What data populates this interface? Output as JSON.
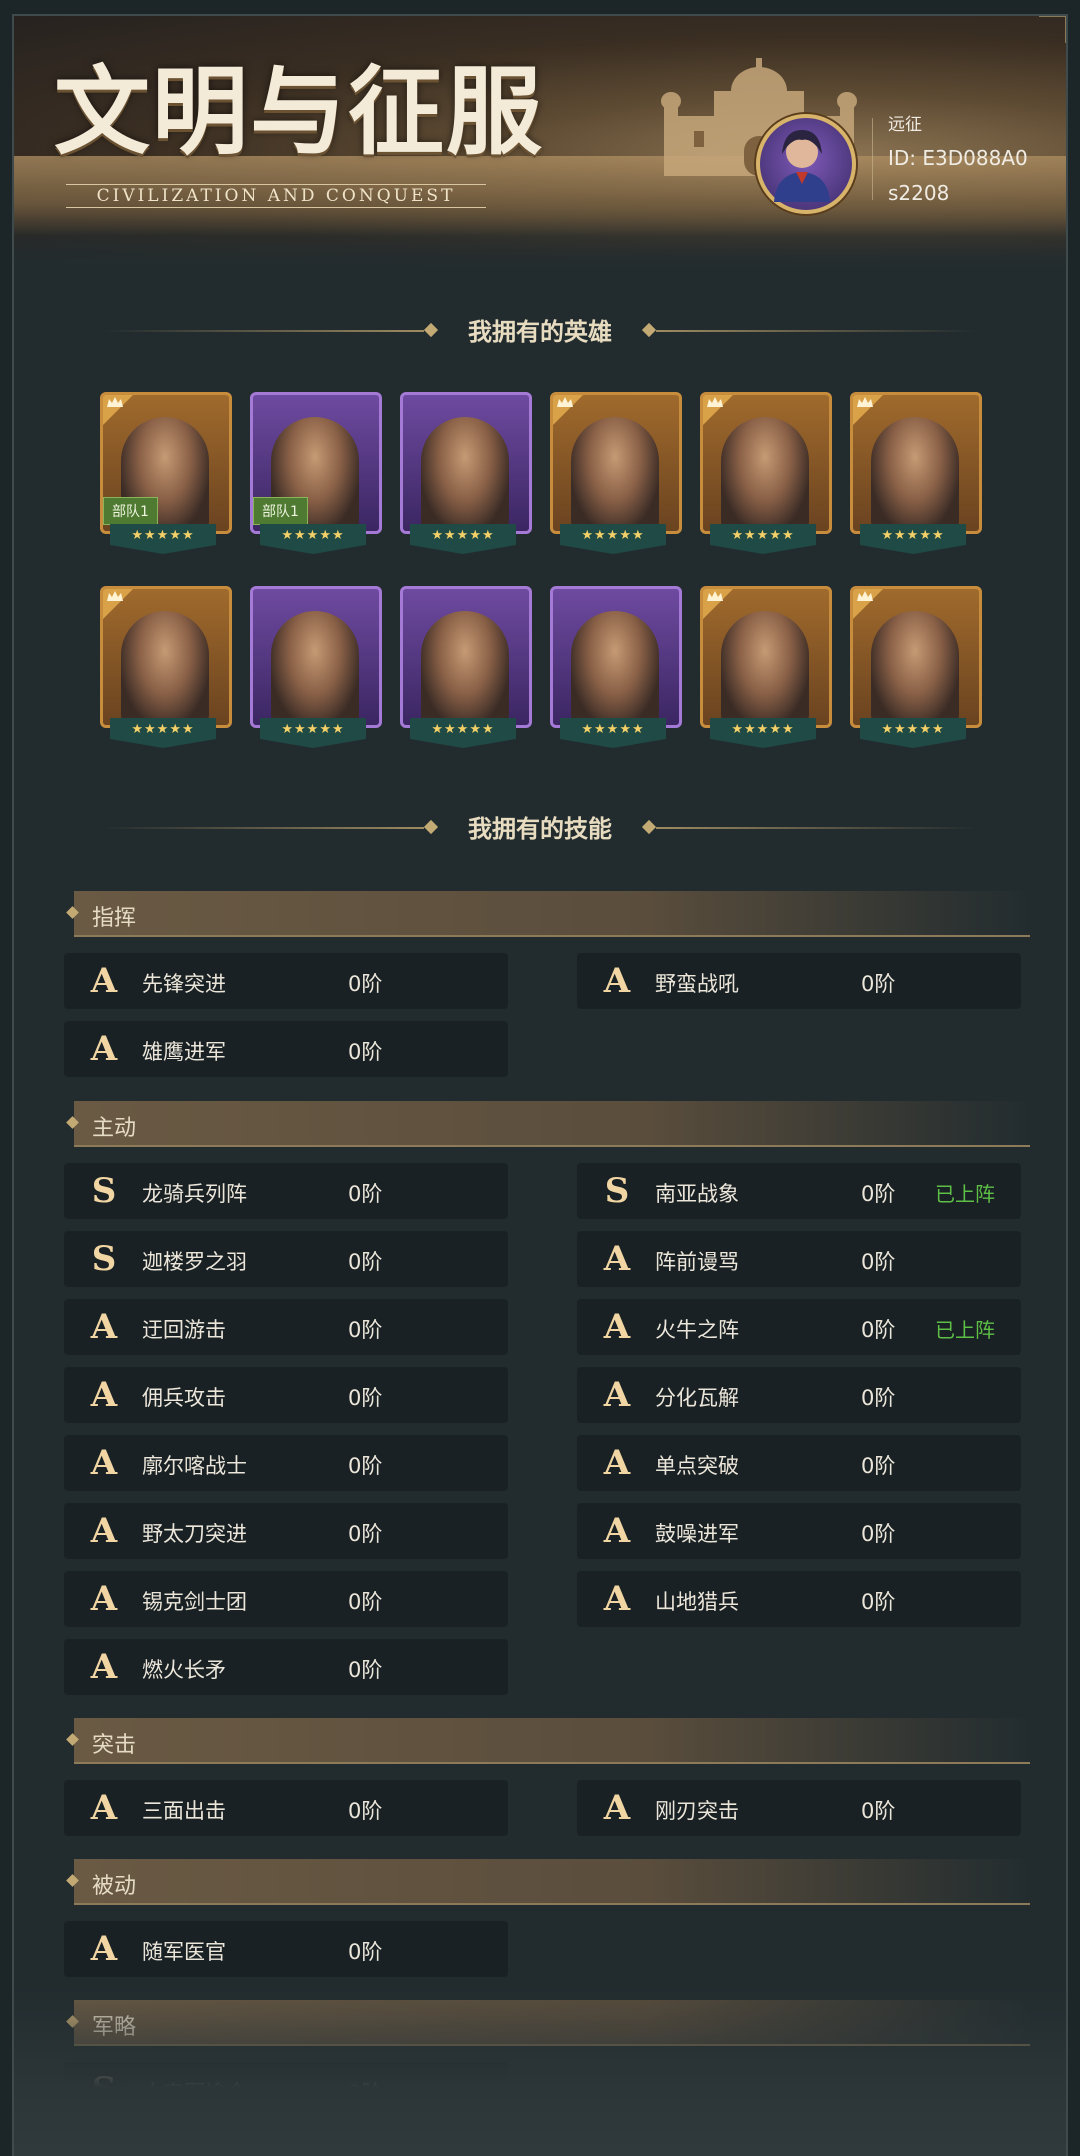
{
  "header": {
    "logo_cn": "文明与征服",
    "logo_en": "CIVILIZATION AND CONQUEST",
    "user_name": "远征",
    "user_id": "ID: E3D088A0",
    "server": "s2208"
  },
  "heroes_section": {
    "title": "我拥有的英雄"
  },
  "heroes": [
    {
      "frame": "gold",
      "troop": "部队1",
      "stars": "★★★★★"
    },
    {
      "frame": "purple",
      "troop": "部队1",
      "stars": "★★★★★"
    },
    {
      "frame": "purple",
      "troop": "",
      "stars": "★★★★★"
    },
    {
      "frame": "gold",
      "troop": "",
      "stars": "★★★★★"
    },
    {
      "frame": "gold",
      "troop": "",
      "stars": "★★★★★"
    },
    {
      "frame": "gold",
      "troop": "",
      "stars": "★★★★★"
    },
    {
      "frame": "gold",
      "troop": "",
      "stars": "★★★★★"
    },
    {
      "frame": "purple",
      "troop": "",
      "stars": "★★★★★"
    },
    {
      "frame": "purple",
      "troop": "",
      "stars": "★★★★★"
    },
    {
      "frame": "purple",
      "troop": "",
      "stars": "★★★★★"
    },
    {
      "frame": "gold",
      "troop": "",
      "stars": "★★★★★"
    },
    {
      "frame": "gold",
      "troop": "",
      "stars": "★★★★★"
    }
  ],
  "skills_section": {
    "title": "我拥有的技能"
  },
  "categories": {
    "command": {
      "label": "指挥",
      "skills": [
        {
          "grade": "A",
          "name": "先锋突进",
          "level": "0阶"
        },
        {
          "grade": "A",
          "name": "野蛮战吼",
          "level": "0阶"
        },
        {
          "grade": "A",
          "name": "雄鹰进军",
          "level": "0阶"
        }
      ]
    },
    "active": {
      "label": "主动",
      "skills": [
        {
          "grade": "S",
          "name": "龙骑兵列阵",
          "level": "0阶",
          "status": ""
        },
        {
          "grade": "S",
          "name": "南亚战象",
          "level": "0阶",
          "status": "已上阵"
        },
        {
          "grade": "S",
          "name": "迦楼罗之羽",
          "level": "0阶",
          "status": ""
        },
        {
          "grade": "A",
          "name": "阵前谩骂",
          "level": "0阶",
          "status": ""
        },
        {
          "grade": "A",
          "name": "迂回游击",
          "level": "0阶",
          "status": ""
        },
        {
          "grade": "A",
          "name": "火牛之阵",
          "level": "0阶",
          "status": "已上阵"
        },
        {
          "grade": "A",
          "name": "佣兵攻击",
          "level": "0阶",
          "status": ""
        },
        {
          "grade": "A",
          "name": "分化瓦解",
          "level": "0阶",
          "status": ""
        },
        {
          "grade": "A",
          "name": "廓尔喀战士",
          "level": "0阶",
          "status": ""
        },
        {
          "grade": "A",
          "name": "单点突破",
          "level": "0阶",
          "status": ""
        },
        {
          "grade": "A",
          "name": "野太刀突进",
          "level": "0阶",
          "status": ""
        },
        {
          "grade": "A",
          "name": "鼓噪进军",
          "level": "0阶",
          "status": ""
        },
        {
          "grade": "A",
          "name": "锡克剑士团",
          "level": "0阶",
          "status": ""
        },
        {
          "grade": "A",
          "name": "山地猎兵",
          "level": "0阶",
          "status": ""
        },
        {
          "grade": "A",
          "name": "燃火长矛",
          "level": "0阶",
          "status": ""
        }
      ]
    },
    "assault": {
      "label": "突击",
      "skills": [
        {
          "grade": "A",
          "name": "三面出击",
          "level": "0阶"
        },
        {
          "grade": "A",
          "name": "刚刃突击",
          "level": "0阶"
        }
      ]
    },
    "passive": {
      "label": "被动",
      "skills": [
        {
          "grade": "A",
          "name": "随军医官",
          "level": "0阶"
        }
      ]
    },
    "tactics": {
      "label": "军略",
      "skills": [
        {
          "grade": "S",
          "name": "十字军谕令",
          "level": "0阶"
        }
      ]
    }
  },
  "colors": {
    "background": "#222c2f",
    "skill_card": "#192124",
    "grade_text": "#f1d6a4",
    "equipped_text": "#5dbf45",
    "gold_frame": "#c88d3c",
    "purple_frame": "#a579d6"
  }
}
